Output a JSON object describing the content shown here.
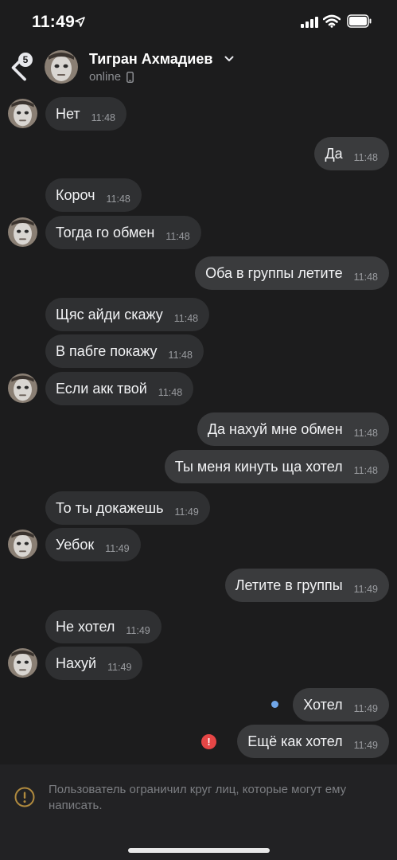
{
  "status_bar": {
    "time": "11:49"
  },
  "header": {
    "back_badge": "5",
    "contact_name": "Тигран Ахмадиев",
    "status": "online"
  },
  "messages": [
    {
      "text": "Нет",
      "time": "11:48",
      "direction": "in"
    },
    {
      "text": "Да",
      "time": "11:48",
      "direction": "out"
    },
    {
      "text": "Короч",
      "time": "11:48",
      "direction": "in"
    },
    {
      "text": "Тогда го обмен",
      "time": "11:48",
      "direction": "in"
    },
    {
      "text": "Оба в группы летите",
      "time": "11:48",
      "direction": "out"
    },
    {
      "text": "Щяс айди скажу",
      "time": "11:48",
      "direction": "in"
    },
    {
      "text": "В пабге покажу",
      "time": "11:48",
      "direction": "in"
    },
    {
      "text": "Если акк твой",
      "time": "11:48",
      "direction": "in"
    },
    {
      "text": "Да нахуй мне обмен",
      "time": "11:48",
      "direction": "out"
    },
    {
      "text": "Ты меня кинуть ща хотел",
      "time": "11:48",
      "direction": "out"
    },
    {
      "text": "То ты докажешь",
      "time": "11:49",
      "direction": "in"
    },
    {
      "text": "Уебок",
      "time": "11:49",
      "direction": "in"
    },
    {
      "text": "Летите в группы",
      "time": "11:49",
      "direction": "out"
    },
    {
      "text": "Не хотел",
      "time": "11:49",
      "direction": "in"
    },
    {
      "text": "Нахуй",
      "time": "11:49",
      "direction": "in"
    },
    {
      "text": "Хотел",
      "time": "11:49",
      "direction": "out",
      "state": "unread"
    },
    {
      "text": "Ещё как хотел",
      "time": "11:49",
      "direction": "out",
      "state": "failed"
    }
  ],
  "footer": {
    "notice": "Пользователь ограничил круг лиц, которые могут ему написать."
  },
  "colors": {
    "background": "#1c1c1d",
    "incoming_bubble": "#2f3032",
    "outgoing_bubble": "#3a3b3d",
    "unread_dot": "#70a6e8",
    "error": "#e64646",
    "warning": "#b08a3e"
  }
}
